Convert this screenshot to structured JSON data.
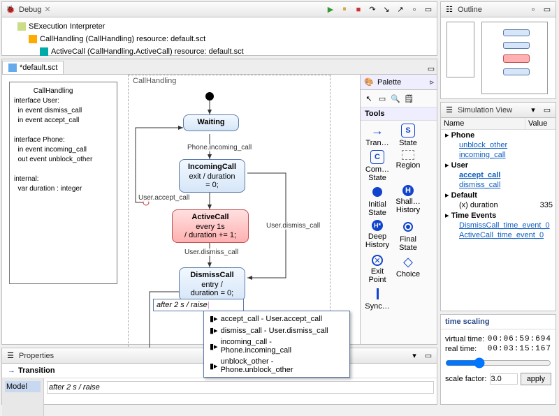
{
  "debug": {
    "title": "Debug",
    "rows": [
      {
        "icon": "#cd8",
        "label": "SExecution Interpreter"
      },
      {
        "icon": "#fa0",
        "label": "CallHandling  (CallHandling) resource: default.sct"
      },
      {
        "icon": "#0aa",
        "label": "ActiveCall  (CallHandling.ActiveCall) resource: default.sct"
      }
    ]
  },
  "outline": {
    "title": "Outline"
  },
  "editor": {
    "tab": "*default.sct",
    "region": "CallHandling",
    "iface": "          CallHandling\ninterface User:\n  in event dismiss_call\n  in event accept_call\n\ninterface Phone:\n  in event incoming_call\n  out event unblock_other\n\ninternal:\n  var duration : integer",
    "states": {
      "waiting": {
        "name": "Waiting",
        "body": ""
      },
      "incoming": {
        "name": "IncomingCall",
        "body": "exit / duration\n= 0;"
      },
      "active": {
        "name": "ActiveCall",
        "body": "every 1s\n/ duration += 1;"
      },
      "dismiss": {
        "name": "DismissCall",
        "body": "entry /\nduration = 0;"
      }
    },
    "trans": {
      "t1": "Phone.incoming_call",
      "t2": "User.accept_call",
      "t3": "User.dismiss_call",
      "t4": "User.dismiss_call"
    },
    "editbox": "after 2 s / raise",
    "popup": [
      "accept_call - User.accept_call",
      "dismiss_call - User.dismiss_call",
      "incoming_call - Phone.incoming_call",
      "unblock_other - Phone.unblock_other"
    ]
  },
  "palette": {
    "title": "Palette",
    "tools_hdr": "Tools",
    "items": [
      "Tran…",
      "State",
      "Com…\nState",
      "Region",
      "Initial\nState",
      "Shall…\nHistory",
      "Deep\nHistory",
      "Final\nState",
      "Exit\nPoint",
      "Choice",
      "Sync…"
    ]
  },
  "sim": {
    "title": "Simulation View",
    "cols": {
      "name": "Name",
      "value": "Value"
    },
    "tree": [
      {
        "t": "grp",
        "l": "Phone"
      },
      {
        "t": "lnk",
        "l": "unblock_other"
      },
      {
        "t": "lnk",
        "l": "incoming_call"
      },
      {
        "t": "grp",
        "l": "User"
      },
      {
        "t": "lnk",
        "l": "accept_call",
        "b": true
      },
      {
        "t": "lnk",
        "l": "dismiss_call"
      },
      {
        "t": "grp",
        "l": "Default"
      },
      {
        "t": "var",
        "l": "duration",
        "v": "335"
      },
      {
        "t": "grp",
        "l": "Time Events"
      },
      {
        "t": "lnk",
        "l": "DismissCall_time_event_0"
      },
      {
        "t": "lnk",
        "l": "ActiveCall_time_event_0"
      }
    ]
  },
  "time": {
    "title": "time scaling",
    "vt_l": "virtual time:",
    "vt": "00:06:59:694",
    "rt_l": "real time:",
    "rt": "00:03:15:167",
    "sf_l": "scale factor:",
    "sf": "3.0",
    "apply": "apply"
  },
  "props": {
    "title": "Properties",
    "section": "Transition",
    "tab": "Model",
    "value": "after 2 s / raise "
  }
}
